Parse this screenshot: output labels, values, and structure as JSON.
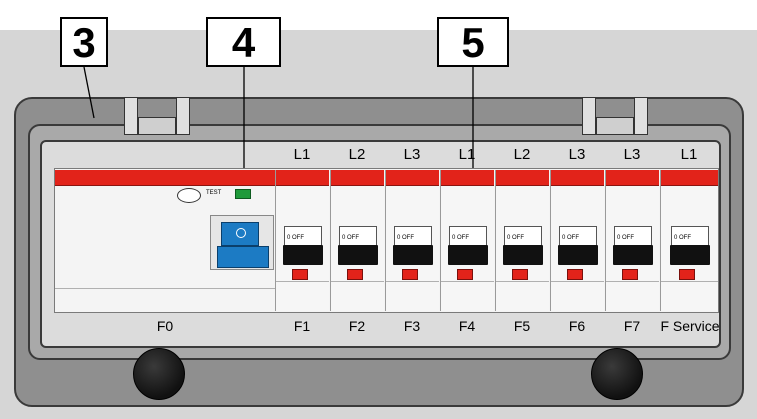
{
  "callouts": [
    "3",
    "4",
    "5"
  ],
  "phases": [
    "L1",
    "L2",
    "L3",
    "L1",
    "L2",
    "L3",
    "L3",
    "L1"
  ],
  "breakers": [
    {
      "label": "F1",
      "toggle": "0 OFF"
    },
    {
      "label": "F2",
      "toggle": "0 OFF"
    },
    {
      "label": "F3",
      "toggle": "0 OFF"
    },
    {
      "label": "F4",
      "toggle": "0 OFF"
    },
    {
      "label": "F5",
      "toggle": "0 OFF"
    },
    {
      "label": "F6",
      "toggle": "0 OFF"
    },
    {
      "label": "F7",
      "toggle": "0 OFF"
    },
    {
      "label": "F Service",
      "toggle": "0 OFF"
    }
  ],
  "rcd": {
    "label": "F0",
    "test_label": "TEST"
  },
  "colors": {
    "red_band": "#e2231a",
    "indicator_green": "#1f9a3a",
    "switch_blue": "#1c7bc4",
    "knob": "#1a1a1a",
    "housing": "#d9d9d9"
  }
}
